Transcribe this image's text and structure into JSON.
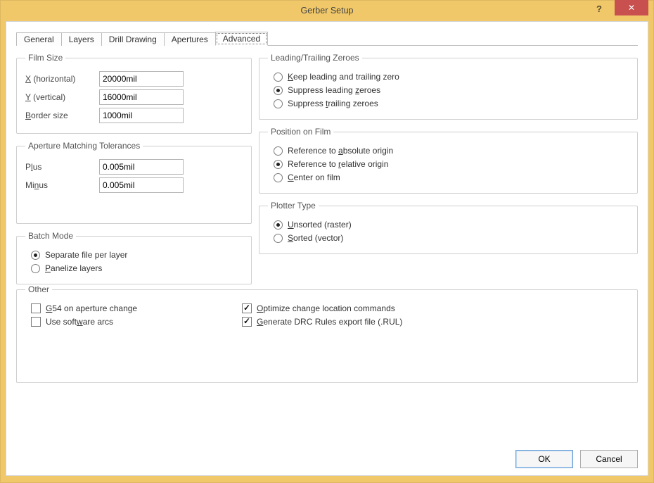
{
  "window": {
    "title": "Gerber Setup",
    "help_icon": "?",
    "close_icon": "✕"
  },
  "tabs": [
    {
      "label": "General",
      "active": false
    },
    {
      "label": "Layers",
      "active": false
    },
    {
      "label": "Drill Drawing",
      "active": false
    },
    {
      "label": "Apertures",
      "active": false
    },
    {
      "label": "Advanced",
      "active": true
    }
  ],
  "film_size": {
    "legend": "Film Size",
    "x_label_pre": "X",
    "x_label_post": " (horizontal)",
    "x_value": "20000mil",
    "y_label_pre": "Y",
    "y_label_post": " (vertical)",
    "y_value": "16000mil",
    "border_label_pre": "B",
    "border_label_post": "order size",
    "border_value": "1000mil"
  },
  "tolerances": {
    "legend": "Aperture Matching Tolerances",
    "plus_label_pre": "P",
    "plus_label_u": "l",
    "plus_label_post": "us",
    "plus_value": "0.005mil",
    "minus_label_pre": "Mi",
    "minus_label_u": "n",
    "minus_label_post": "us",
    "minus_value": "0.005mil"
  },
  "zeroes": {
    "legend": "Leading/Trailing Zeroes",
    "keep_pre": "",
    "keep_u": "K",
    "keep_post": "eep leading and trailing zero",
    "sup_lead_pre": "Suppress leading ",
    "sup_lead_u": "z",
    "sup_lead_post": "eroes",
    "sup_trail_pre": "Suppress ",
    "sup_trail_u": "t",
    "sup_trail_post": "railing zeroes",
    "selected": "sup_lead"
  },
  "position": {
    "legend": "Position on Film",
    "abs_pre": "Reference to ",
    "abs_u": "a",
    "abs_post": "bsolute origin",
    "rel_pre": "Reference to ",
    "rel_u": "r",
    "rel_post": "elative origin",
    "center_pre": "",
    "center_u": "C",
    "center_post": "enter on film",
    "selected": "rel"
  },
  "batch": {
    "legend": "Batch Mode",
    "sep_label": "Separate file per layer",
    "pan_pre": "",
    "pan_u": "P",
    "pan_post": "anelize layers",
    "selected": "sep"
  },
  "plotter": {
    "legend": "Plotter Type",
    "unsorted_pre": "",
    "unsorted_u": "U",
    "unsorted_post": "nsorted (raster)",
    "sorted_pre": "",
    "sorted_u": "S",
    "sorted_post": "orted (vector)",
    "selected": "unsorted"
  },
  "other": {
    "legend": "Other",
    "g54_pre": "",
    "g54_u": "G",
    "g54_post": "54 on aperture change",
    "g54_checked": false,
    "arcs_pre": "Use soft",
    "arcs_u": "w",
    "arcs_post": "are arcs",
    "arcs_checked": false,
    "opt_pre": "",
    "opt_u": "O",
    "opt_post": "ptimize change location commands",
    "opt_checked": true,
    "drc_pre": "",
    "drc_u": "G",
    "drc_post": "enerate DRC Rules export file (.RUL)",
    "drc_checked": true
  },
  "buttons": {
    "ok": "OK",
    "cancel": "Cancel"
  }
}
